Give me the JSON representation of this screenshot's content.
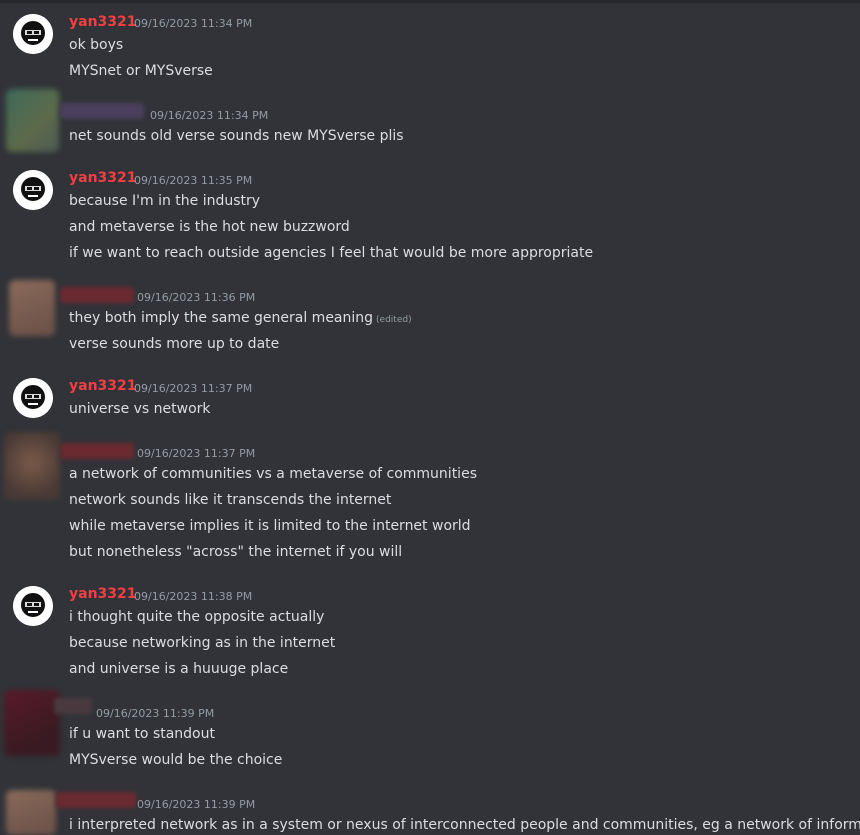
{
  "messages": [
    {
      "author": "yan3321",
      "timestamp": "09/16/2023 11:34 PM",
      "lines": [
        "ok boys",
        "MYSnet or MYSverse"
      ]
    },
    {
      "author": "",
      "timestamp": "09/16/2023 11:34 PM",
      "lines": [
        "net sounds old verse sounds new MYSverse plis"
      ]
    },
    {
      "author": "yan3321",
      "timestamp": "09/16/2023 11:35 PM",
      "lines": [
        "because I'm in the industry",
        "and metaverse is the hot new buzzword",
        "if we want to reach outside agencies I feel that would be more appropriate"
      ]
    },
    {
      "author": "",
      "timestamp": "09/16/2023 11:36 PM",
      "lines": [
        "they both imply the same general meaning",
        "verse sounds more up to date"
      ],
      "edited_label": "(edited)"
    },
    {
      "author": "yan3321",
      "timestamp": "09/16/2023 11:37 PM",
      "lines": [
        "universe vs network"
      ]
    },
    {
      "author": "",
      "timestamp": "09/16/2023 11:37 PM",
      "lines": [
        "a network of communities vs a metaverse of communities",
        "network sounds like it transcends the internet",
        "while metaverse implies it is limited to the internet world",
        "but nonetheless \"across\" the internet if you will"
      ]
    },
    {
      "author": "yan3321",
      "timestamp": "09/16/2023 11:38 PM",
      "lines": [
        "i thought quite the opposite actually",
        "because networking as in the internet",
        "and universe is a huuuge place"
      ]
    },
    {
      "author": "",
      "timestamp": "09/16/2023 11:39 PM",
      "lines": [
        "if u want to standout",
        "MYSverse would be the choice"
      ]
    },
    {
      "author": "",
      "timestamp": "09/16/2023 11:39 PM",
      "lines": [
        "i interpreted network as in a system or nexus of interconnected people and communities, eg a network of informants"
      ]
    }
  ],
  "colors": {
    "background": "#313338",
    "username_red": "#f23f42",
    "text": "#dbdee1",
    "muted": "#949ba4"
  }
}
